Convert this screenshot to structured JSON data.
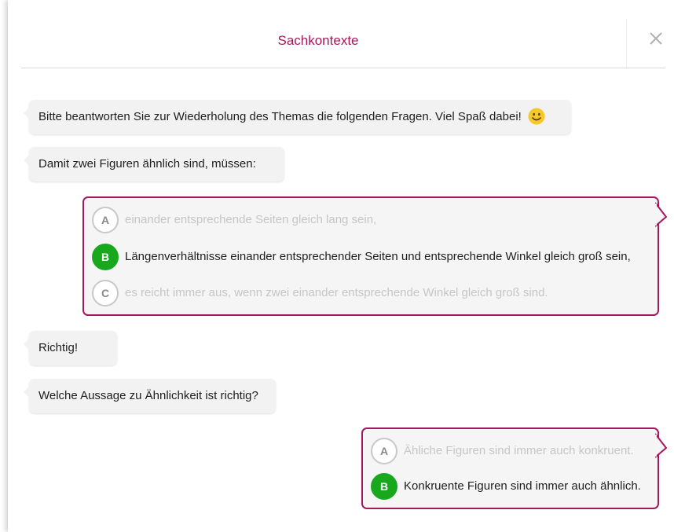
{
  "header": {
    "title": "Sachkontexte",
    "close_icon": "close-icon"
  },
  "colors": {
    "accent": "#a3195b",
    "correct": "#17a81d",
    "bubble_bg": "#f2f2f2",
    "muted_text": "#c6c6c6"
  },
  "messages": [
    {
      "text": "Bitte beantworten Sie zur Wiederholung des Themas die folgenden Fragen. Viel Spaß dabei!",
      "icon": "smiley-icon"
    },
    {
      "text": "Damit zwei Figuren ähnlich sind, müssen:"
    },
    {
      "text": "Richtig!"
    },
    {
      "text": "Welche Aussage zu Ähnlichkeit ist richtig?"
    }
  ],
  "question1": {
    "options": [
      {
        "letter": "A",
        "text": "einander entsprechende Seiten gleich lang sein,",
        "selected": false
      },
      {
        "letter": "B",
        "text": "Längenverhältnisse einander entsprechender Seiten und entsprechende Winkel gleich groß sein,",
        "selected": true
      },
      {
        "letter": "C",
        "text": "es reicht immer aus, wenn zwei einander entsprechende Winkel gleich groß sind.",
        "selected": false
      }
    ]
  },
  "question2": {
    "options": [
      {
        "letter": "A",
        "text": "Ähliche Figuren sind immer auch konkruent.",
        "selected": false
      },
      {
        "letter": "B",
        "text": "Konkruente Figuren sind immer auch ähnlich.",
        "selected": true
      }
    ]
  }
}
